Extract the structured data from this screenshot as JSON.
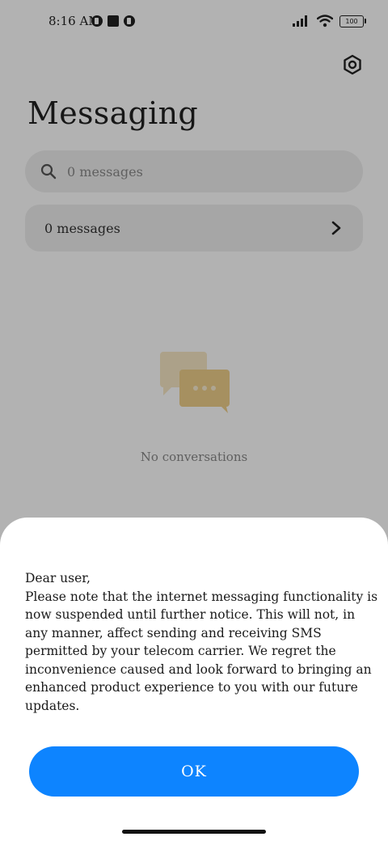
{
  "status_bar": {
    "time": "8:16 AM",
    "battery": "100"
  },
  "header": {
    "title": "Messaging"
  },
  "search": {
    "placeholder": "0 messages"
  },
  "message_row": {
    "label": "0 messages"
  },
  "empty_state": {
    "text": "No conversations"
  },
  "dialog": {
    "body": "Dear user,\nPlease note that the internet messaging functionality is now suspended until further notice. This will not, in any manner, affect sending and receiving SMS permitted by your telecom carrier. We regret the inconvenience caused and look forward to bringing an enhanced product experience to you with our future updates.",
    "ok_label": "OK"
  },
  "colors": {
    "accent": "#0d84ff",
    "illustration": "#f0c97a"
  },
  "icons": {
    "settings": "settings-gear-icon",
    "search": "search-icon",
    "chevron": "chevron-right-icon",
    "signal": "cellular-signal-icon",
    "wifi": "wifi-icon",
    "battery": "battery-icon"
  }
}
